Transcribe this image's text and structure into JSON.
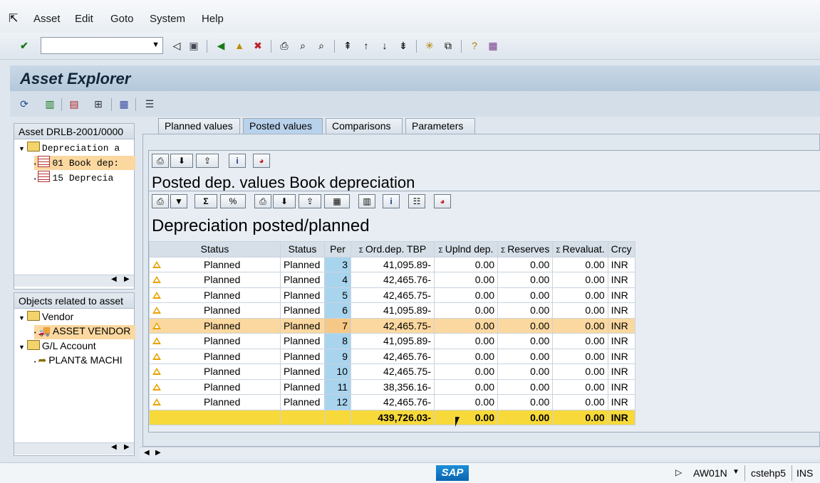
{
  "menubar": {
    "items": [
      "Asset",
      "Edit",
      "Goto",
      "System",
      "Help"
    ]
  },
  "toolbar": {
    "command_value": ""
  },
  "title": "Asset Explorer",
  "left": {
    "asset_header": "Asset DRLB-2001/0000",
    "tree": {
      "depreciation": "Depreciation a",
      "book": "01 Book dep:",
      "tax": "15 Deprecia"
    },
    "objects_header": "Objects related to asset",
    "vendor": "Vendor",
    "asset_vendor": "ASSET VENDOR",
    "gl_account": "G/L Account",
    "plant": "PLANT& MACHI"
  },
  "tabs": [
    "Planned values",
    "Posted values",
    "Comparisons",
    "Parameters"
  ],
  "posted_title": "Posted dep. values Book depreciation",
  "grid_title": "Depreciation posted/planned",
  "columns": [
    "Status",
    "Status",
    "Per",
    "Ord.dep. TBP",
    "Uplnd dep.",
    "Reserves",
    "Revaluat.",
    "Crcy"
  ],
  "rows": [
    {
      "status1": "Planned",
      "status2": "Planned",
      "per": "3",
      "ord": "41,095.89-",
      "uplnd": "0.00",
      "reserves": "0.00",
      "reval": "0.00",
      "crcy": "INR"
    },
    {
      "status1": "Planned",
      "status2": "Planned",
      "per": "4",
      "ord": "42,465.76-",
      "uplnd": "0.00",
      "reserves": "0.00",
      "reval": "0.00",
      "crcy": "INR"
    },
    {
      "status1": "Planned",
      "status2": "Planned",
      "per": "5",
      "ord": "42,465.75-",
      "uplnd": "0.00",
      "reserves": "0.00",
      "reval": "0.00",
      "crcy": "INR"
    },
    {
      "status1": "Planned",
      "status2": "Planned",
      "per": "6",
      "ord": "41,095.89-",
      "uplnd": "0.00",
      "reserves": "0.00",
      "reval": "0.00",
      "crcy": "INR"
    },
    {
      "status1": "Planned",
      "status2": "Planned",
      "per": "7",
      "ord": "42,465.75-",
      "uplnd": "0.00",
      "reserves": "0.00",
      "reval": "0.00",
      "crcy": "INR"
    },
    {
      "status1": "Planned",
      "status2": "Planned",
      "per": "8",
      "ord": "41,095.89-",
      "uplnd": "0.00",
      "reserves": "0.00",
      "reval": "0.00",
      "crcy": "INR"
    },
    {
      "status1": "Planned",
      "status2": "Planned",
      "per": "9",
      "ord": "42,465.76-",
      "uplnd": "0.00",
      "reserves": "0.00",
      "reval": "0.00",
      "crcy": "INR"
    },
    {
      "status1": "Planned",
      "status2": "Planned",
      "per": "10",
      "ord": "42,465.75-",
      "uplnd": "0.00",
      "reserves": "0.00",
      "reval": "0.00",
      "crcy": "INR"
    },
    {
      "status1": "Planned",
      "status2": "Planned",
      "per": "11",
      "ord": "38,356.16-",
      "uplnd": "0.00",
      "reserves": "0.00",
      "reval": "0.00",
      "crcy": "INR"
    },
    {
      "status1": "Planned",
      "status2": "Planned",
      "per": "12",
      "ord": "42,465.76-",
      "uplnd": "0.00",
      "reserves": "0.00",
      "reval": "0.00",
      "crcy": "INR"
    }
  ],
  "totals": {
    "ord": "439,726.03-",
    "uplnd": "0.00",
    "reserves": "0.00",
    "reval": "0.00",
    "crcy": "INR"
  },
  "status": {
    "logo": "SAP",
    "transaction": "AW01N",
    "server": "cstehp5",
    "mode": "INS"
  }
}
